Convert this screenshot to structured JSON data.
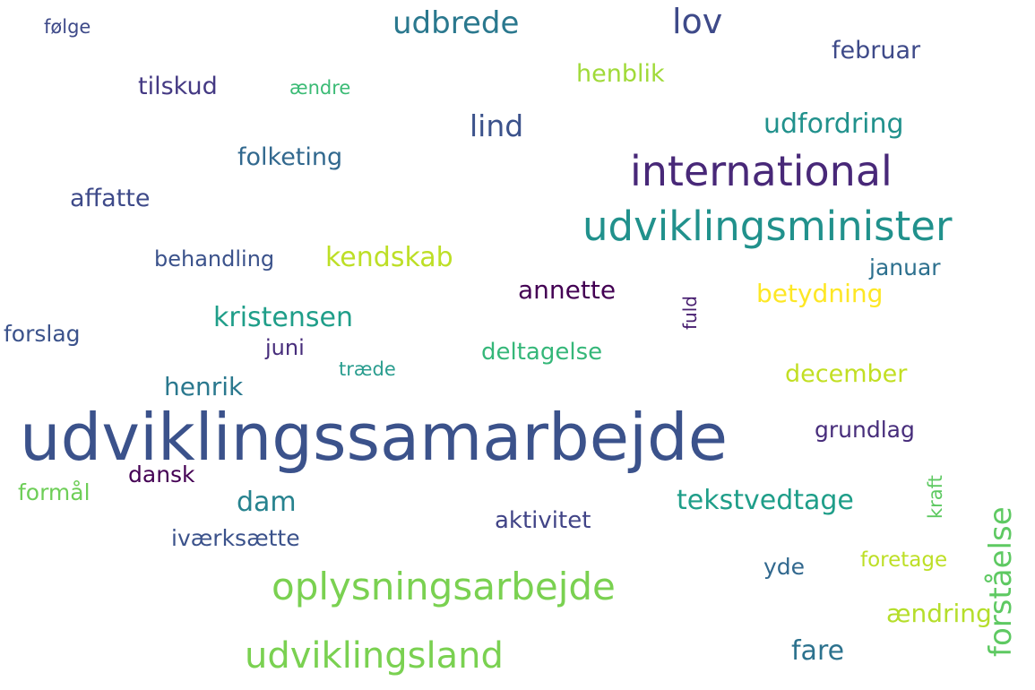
{
  "words": [
    {
      "text": "udviklingssamarbejde",
      "color": "#3b528b"
    },
    {
      "text": "international",
      "color": "#482878"
    },
    {
      "text": "udviklingsminister",
      "color": "#21918c"
    },
    {
      "text": "oplysningsarbejde",
      "color": "#7ad151"
    },
    {
      "text": "udviklingsland",
      "color": "#7ad151"
    },
    {
      "text": "lov",
      "color": "#3e4a89"
    },
    {
      "text": "udbrede",
      "color": "#2a788e"
    },
    {
      "text": "forståelse",
      "color": "#5ec962"
    },
    {
      "text": "kristensen",
      "color": "#1f9e89"
    },
    {
      "text": "annette",
      "color": "#440154"
    },
    {
      "text": "tekstvedtage",
      "color": "#1f9e89"
    },
    {
      "text": "kendskab",
      "color": "#bddf26"
    },
    {
      "text": "lind",
      "color": "#3b528b"
    },
    {
      "text": "udfordring",
      "color": "#21918c"
    },
    {
      "text": "henrik",
      "color": "#2a788e"
    },
    {
      "text": "dam",
      "color": "#26828e"
    },
    {
      "text": "fare",
      "color": "#2c728e"
    },
    {
      "text": "betydning",
      "color": "#fde725"
    },
    {
      "text": "deltagelse",
      "color": "#35b779"
    },
    {
      "text": "december",
      "color": "#c2df23"
    },
    {
      "text": "ændring",
      "color": "#b5de2b"
    },
    {
      "text": "aktivitet",
      "color": "#414487"
    },
    {
      "text": "grundlag",
      "color": "#472d7b"
    },
    {
      "text": "folketing",
      "color": "#31688e"
    },
    {
      "text": "tilskud",
      "color": "#443983"
    },
    {
      "text": "februar",
      "color": "#3e4a89"
    },
    {
      "text": "henblik",
      "color": "#a0da39"
    },
    {
      "text": "affatte",
      "color": "#3e4a89"
    },
    {
      "text": "behandling",
      "color": "#3b528b"
    },
    {
      "text": "januar",
      "color": "#2d708e"
    },
    {
      "text": "forslag",
      "color": "#3b528b"
    },
    {
      "text": "juni",
      "color": "#472d7b"
    },
    {
      "text": "dansk",
      "color": "#440154"
    },
    {
      "text": "formål",
      "color": "#6ece58"
    },
    {
      "text": "iværksætte",
      "color": "#3b528b"
    },
    {
      "text": "yde",
      "color": "#31688e"
    },
    {
      "text": "foretage",
      "color": "#bddf26"
    },
    {
      "text": "kraft",
      "color": "#5ec962"
    },
    {
      "text": "fuld",
      "color": "#481f70"
    },
    {
      "text": "træde",
      "color": "#2a9d8f"
    },
    {
      "text": "ændre",
      "color": "#3bbb75"
    },
    {
      "text": "følge",
      "color": "#3e4a89"
    }
  ]
}
